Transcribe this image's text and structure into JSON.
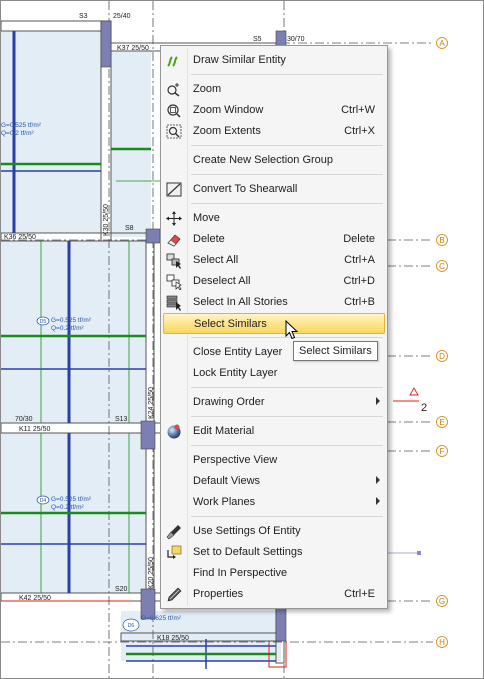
{
  "plan": {
    "grid_axes": [
      {
        "label": "A",
        "color": "#d08000"
      },
      {
        "label": "B",
        "color": "#d08000"
      },
      {
        "label": "C",
        "color": "#d08000"
      },
      {
        "label": "D",
        "color": "#d08000"
      },
      {
        "label": "E",
        "color": "#d08000"
      },
      {
        "label": "F",
        "color": "#d08000"
      },
      {
        "label": "G",
        "color": "#d08000"
      },
      {
        "label": "H",
        "color": "#d08000"
      }
    ],
    "column_labels": {
      "s3": "S3",
      "s3_size": "25/40",
      "s5": "S5",
      "s5_size": "30/70",
      "s8": "S8",
      "s13": "S13",
      "s13_size": "70/30",
      "s20": "S20"
    },
    "beam_labels": {
      "k37": "K37 25/50",
      "k36": "K36 25/50",
      "k11": "K11 25/50",
      "k42": "K42 25/50",
      "k18": "K18 25/50",
      "k30v": "K30 25/50",
      "k24v": "K24 25/50",
      "k20v": "K20 25/50"
    },
    "load_texts": {
      "g1": "G=0.525 tf/m²",
      "q1": "Q=0.2 tf/m²",
      "g2": "G=0.525 tf/m²",
      "q2": "Q=0.2 tf/m²",
      "g3": "G=0.525 tf/m²",
      "q3": "Q=0.2 tf/m²",
      "g4": "G=0.625 tf/m²"
    },
    "slab_tags": {
      "d1": "D5",
      "d2": "D4",
      "d3": "D3",
      "d4": "D6"
    },
    "level_number": "2",
    "colors": {
      "beam": "#2a3ea8",
      "rebar": "#1a8a1a",
      "slab": "#e3edf6",
      "column": "#7d7fb3"
    }
  },
  "context_menu": {
    "items": [
      {
        "label": "Draw Similar Entity",
        "icon": "draw-similar-icon",
        "shortcut": ""
      },
      {
        "label": "Zoom",
        "icon": "zoom-icon",
        "shortcut": ""
      },
      {
        "label": "Zoom Window",
        "icon": "zoom-window-icon",
        "shortcut": "Ctrl+W"
      },
      {
        "label": "Zoom Extents",
        "icon": "zoom-extents-icon",
        "shortcut": "Ctrl+X"
      },
      {
        "label": "Create New Selection Group",
        "icon": "",
        "shortcut": ""
      },
      {
        "label": "Convert To Shearwall",
        "icon": "convert-shearwall-icon",
        "shortcut": ""
      },
      {
        "label": "Move",
        "icon": "move-icon",
        "shortcut": ""
      },
      {
        "label": "Delete",
        "icon": "eraser-icon",
        "shortcut": "Delete"
      },
      {
        "label": "Select All",
        "icon": "select-all-icon",
        "shortcut": "Ctrl+A"
      },
      {
        "label": "Deselect All",
        "icon": "deselect-all-icon",
        "shortcut": "Ctrl+D"
      },
      {
        "label": "Select In All Stories",
        "icon": "select-stories-icon",
        "shortcut": "Ctrl+B"
      },
      {
        "label": "Select Similars",
        "icon": "",
        "shortcut": ""
      },
      {
        "label": "Close Entity Layer",
        "icon": "",
        "shortcut": ""
      },
      {
        "label": "Lock Entity Layer",
        "icon": "",
        "shortcut": ""
      },
      {
        "label": "Drawing Order",
        "icon": "",
        "shortcut": ""
      },
      {
        "label": "Edit Material",
        "icon": "material-sphere-icon",
        "shortcut": ""
      },
      {
        "label": "Perspective View",
        "icon": "",
        "shortcut": ""
      },
      {
        "label": "Default Views",
        "icon": "",
        "shortcut": ""
      },
      {
        "label": "Work Planes",
        "icon": "",
        "shortcut": ""
      },
      {
        "label": "Use Settings Of Entity",
        "icon": "eyedropper-icon",
        "shortcut": ""
      },
      {
        "label": "Set to Default Settings",
        "icon": "default-settings-icon",
        "shortcut": ""
      },
      {
        "label": "Find In Perspective",
        "icon": "",
        "shortcut": ""
      },
      {
        "label": "Properties",
        "icon": "properties-icon",
        "shortcut": "Ctrl+E"
      }
    ],
    "highlighted": "Select Similars"
  },
  "tooltip": {
    "text": "Select Similars"
  }
}
